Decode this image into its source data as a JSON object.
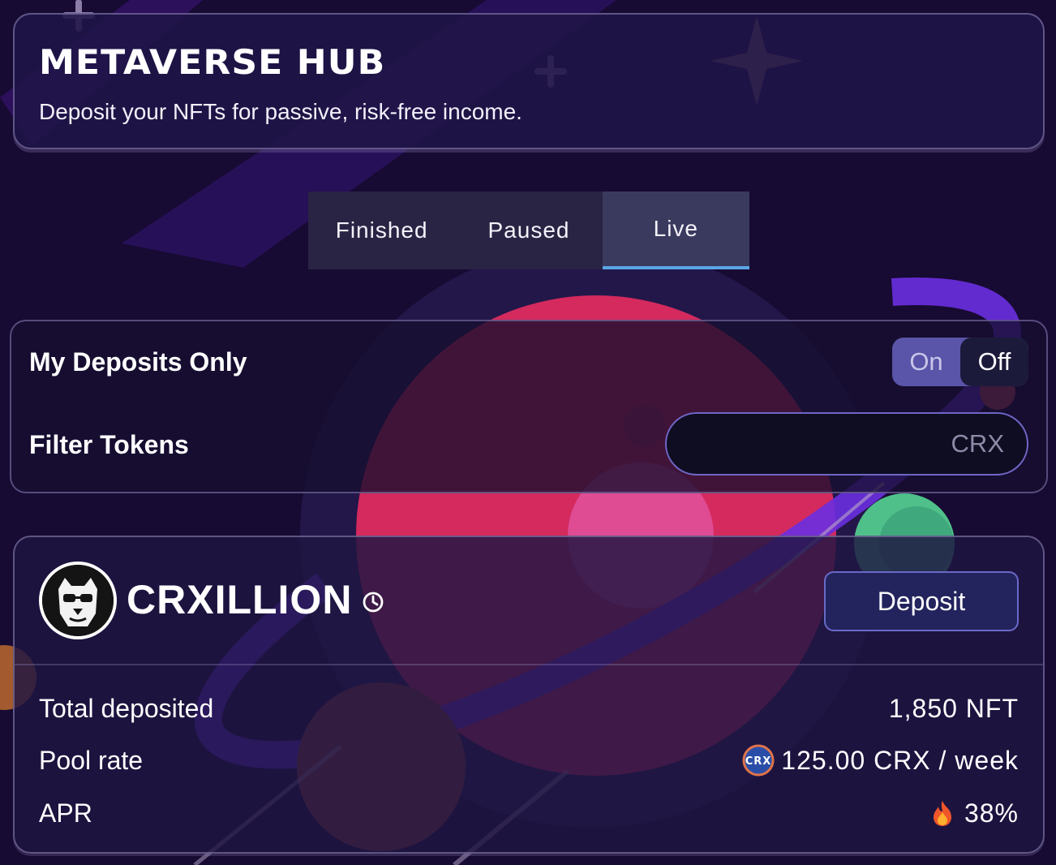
{
  "header": {
    "title": "METAVERSE HUB",
    "subtitle": "Deposit your NFTs for passive, risk-free income."
  },
  "tabs": [
    {
      "label": "Finished",
      "active": false
    },
    {
      "label": "Paused",
      "active": false
    },
    {
      "label": "Live",
      "active": true
    }
  ],
  "filters": {
    "my_deposits_label": "My Deposits Only",
    "toggle": {
      "on_label": "On",
      "off_label": "Off",
      "selected": "Off"
    },
    "filter_tokens_label": "Filter Tokens",
    "filter_tokens_placeholder": "CRX"
  },
  "pool": {
    "name": "CRXILLION",
    "deposit_label": "Deposit",
    "stats": [
      {
        "label": "Total deposited",
        "value": "1,850 NFT",
        "icon": null
      },
      {
        "label": "Pool rate",
        "value": "125.00 CRX / week",
        "icon": "crx-token-icon"
      },
      {
        "label": "APR",
        "value": "38%",
        "icon": "fire-icon"
      }
    ]
  },
  "colors": {
    "background": "#170a33",
    "accent_tab": "#5aa6e6",
    "toggle_bg": "#5a55a8",
    "deposit_bg": "#23235e",
    "planet": "#d42a5e"
  }
}
